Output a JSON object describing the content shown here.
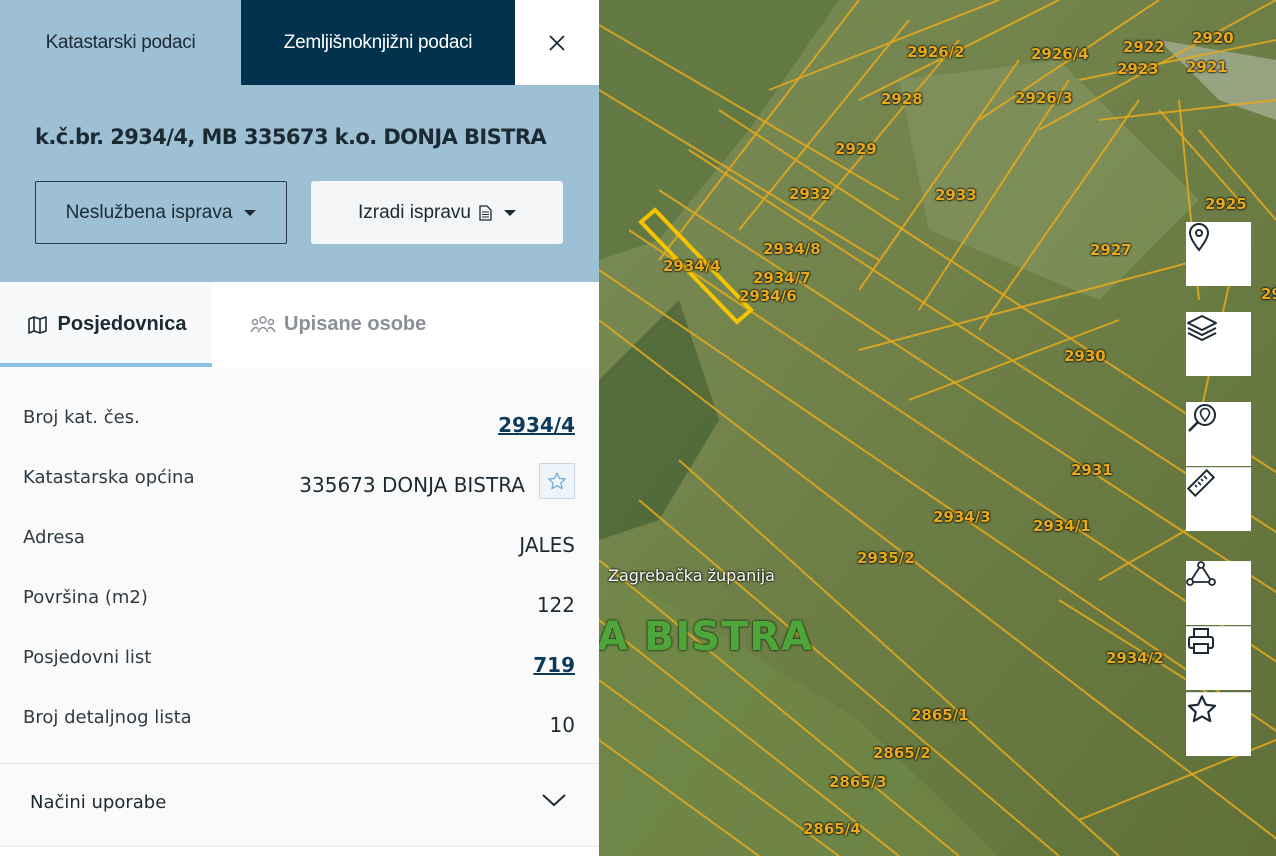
{
  "top_tabs": {
    "cadastral": "Katastarski podaci",
    "land_registry": "Zemljišnoknjižni podaci"
  },
  "header": {
    "title": "k.č.br. 2934/4, MB 335673 k.o. DONJA BISTRA",
    "unofficial_button": "Neslužbena isprava",
    "create_button": "Izradi ispravu"
  },
  "sub_tabs": {
    "holdings": "Posjedovnica",
    "registered_persons": "Upisane osobe"
  },
  "details": [
    {
      "label": "Broj kat. čes.",
      "value": "2934/4"
    },
    {
      "label": "Katastarska općina",
      "value": "335673 DONJA BISTRA"
    },
    {
      "label": "Adresa",
      "value": "JALES"
    },
    {
      "label": "Površina (m2)",
      "value": "122"
    },
    {
      "label": "Posjedovni list",
      "value": "719"
    },
    {
      "label": "Broj detaljnog lista",
      "value": "10"
    }
  ],
  "accordion": {
    "usage_label": "Načini uporabe"
  },
  "map": {
    "county_label": "Zagrebačka županija",
    "village_label": "A BISTRA",
    "parcels": [
      "2926/2",
      "2926/4",
      "2922",
      "2920",
      "2923",
      "2921",
      "2928",
      "2926/3",
      "2929",
      "2932",
      "2933",
      "2925",
      "2934/8",
      "2927",
      "2934/4",
      "2934/7",
      "2934/6",
      "29",
      "2930",
      "2931",
      "2934/3",
      "2934/1",
      "2935/2",
      "2934/2",
      "2865/1",
      "2865/2",
      "2865/3",
      "2865/4"
    ]
  },
  "colors": {
    "header_bg": "#9ec0d5",
    "active_tab_bg": "#03324f",
    "parcel_line": "#e8a91c",
    "selected_parcel": "#f5c400"
  },
  "icons": [
    "close-icon",
    "map-icon",
    "people-icon",
    "document-icon",
    "star-icon",
    "location-pin-icon",
    "layers-icon",
    "search-location-icon",
    "ruler-icon",
    "polygon-icon",
    "printer-icon"
  ]
}
